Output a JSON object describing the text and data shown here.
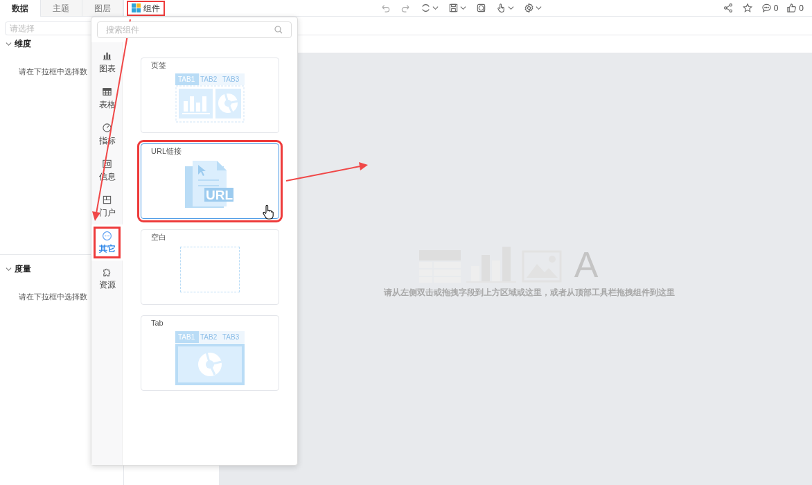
{
  "side_tabs": [
    {
      "label": "数据",
      "selected": true
    },
    {
      "label": "主题",
      "selected": false
    },
    {
      "label": "图层",
      "selected": false
    }
  ],
  "field_select": {
    "placeholder": "请选择"
  },
  "sections": [
    {
      "title": "维度",
      "expanded": true,
      "hint": "请在下拉框中选择数"
    },
    {
      "title": "度量",
      "expanded": true,
      "hint": "请在下拉框中选择数"
    }
  ],
  "component_button": {
    "label": "组件",
    "highlighted": true
  },
  "toolbar": {
    "comments": "0",
    "likes": "0"
  },
  "popup": {
    "search": {
      "placeholder": "搜索组件"
    },
    "categories": [
      {
        "label": "图表",
        "kind": "chart",
        "selected": false,
        "highlighted": false
      },
      {
        "label": "表格",
        "kind": "table",
        "selected": false,
        "highlighted": false
      },
      {
        "label": "指标",
        "kind": "gauge",
        "selected": false,
        "highlighted": false
      },
      {
        "label": "信息",
        "kind": "info",
        "selected": false,
        "highlighted": false
      },
      {
        "label": "门户",
        "kind": "portal",
        "selected": false,
        "highlighted": false
      },
      {
        "label": "其它",
        "kind": "more",
        "selected": true,
        "highlighted": true
      },
      {
        "label": "资源",
        "kind": "puzzle",
        "selected": false,
        "highlighted": false
      }
    ],
    "cards": [
      {
        "title": "页签",
        "kind": "tabs",
        "highlighted": false,
        "tab_labels": [
          "TAB1",
          "TAB2",
          "TAB3"
        ]
      },
      {
        "title": "URL链接",
        "kind": "url",
        "highlighted": true,
        "badge": "URL"
      },
      {
        "title": "空白",
        "kind": "blank",
        "highlighted": false
      },
      {
        "title": "Tab",
        "kind": "tab",
        "highlighted": false,
        "tab_labels": [
          "TAB1",
          "TAB2",
          "TAB3"
        ]
      }
    ]
  },
  "canvas": {
    "letter_icon": "A",
    "hint": "请从左侧双击或拖拽字段到上方区域或这里，或者从顶部工具栏拖拽组件到这里"
  }
}
